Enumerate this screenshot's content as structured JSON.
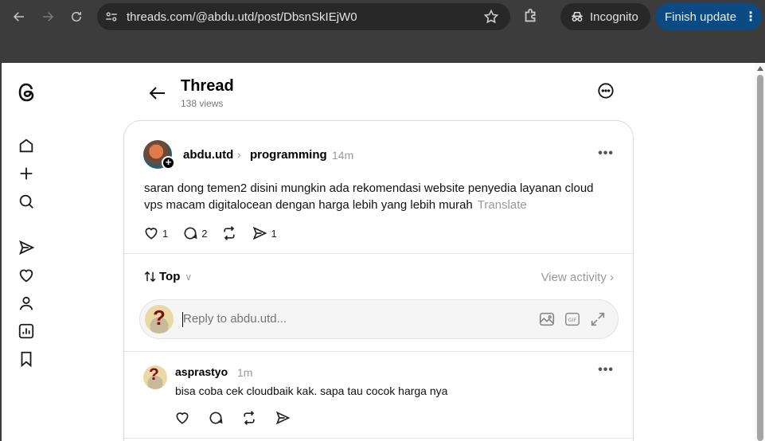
{
  "browser": {
    "url": "threads.com/@abdu.utd/post/DbsnSkIEjW0",
    "incognito_label": "Incognito",
    "finish_update_label": "Finish update",
    "menu_glyph": "⋮"
  },
  "header": {
    "title": "Thread",
    "views": "138 views"
  },
  "post": {
    "username": "abdu.utd",
    "topic": "programming",
    "time": "14m",
    "text": "saran dong temen2 disini mungkin ada rekomendasi website penyedia layanan cloud vps macam digitalocean dengan harga lebih yang lebih murah",
    "translate": "Translate",
    "likes": "1",
    "replies": "2",
    "shares": "1",
    "more_glyph": "•••"
  },
  "sort": {
    "label": "Top",
    "view_activity": "View activity"
  },
  "reply": {
    "placeholder": "Reply to abdu.utd..."
  },
  "comments": [
    {
      "username": "asprastyo",
      "time": "1m",
      "text": "bisa coba cek cloudbaik kak. sapa tau cocok harga nya"
    }
  ],
  "colors": {
    "chrome_bg": "#3c3c3c",
    "omnibox_bg": "#282828",
    "finish_bg": "#0b4a82",
    "muted_text": "#999999"
  }
}
